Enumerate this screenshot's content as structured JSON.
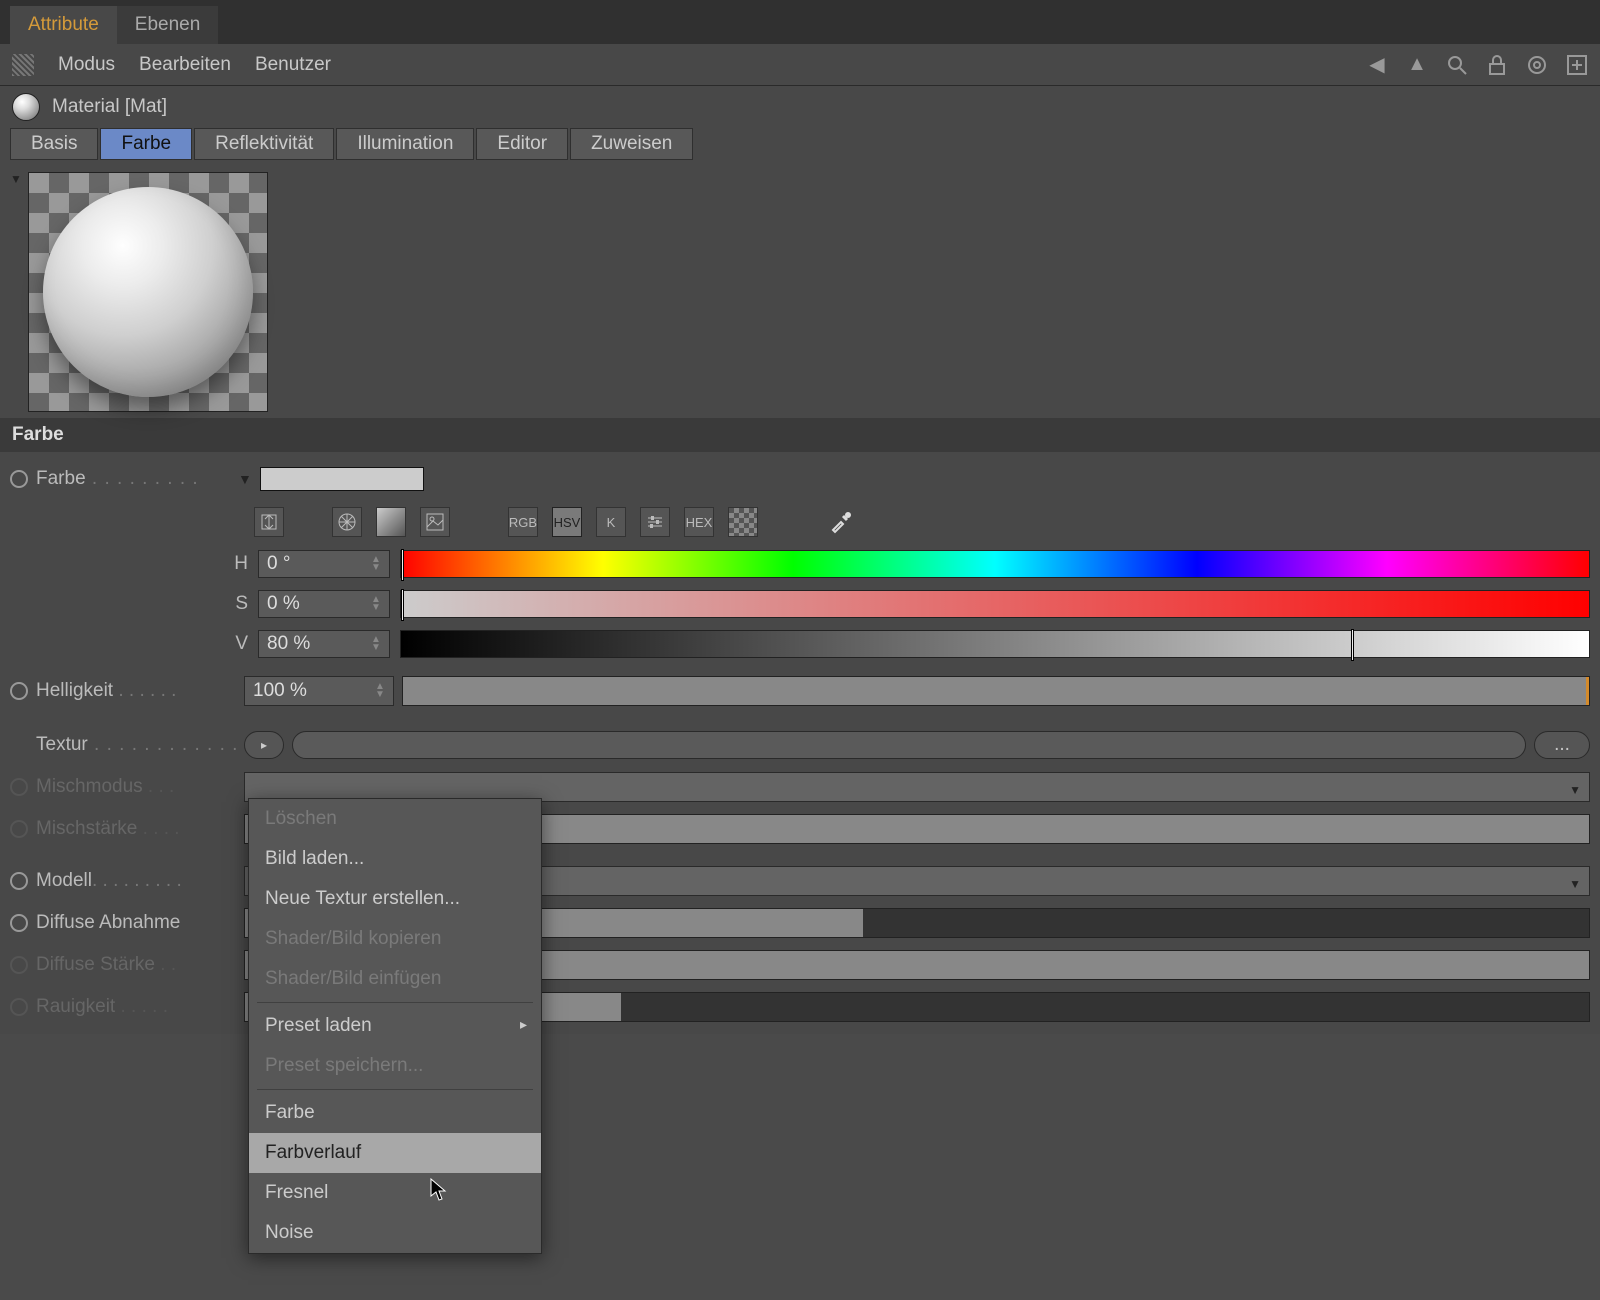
{
  "tabs": {
    "attribute": "Attribute",
    "layers": "Ebenen"
  },
  "menu": {
    "modus": "Modus",
    "bearbeiten": "Bearbeiten",
    "benutzer": "Benutzer"
  },
  "material": {
    "title": "Material [Mat]"
  },
  "mtabs": {
    "basis": "Basis",
    "farbe": "Farbe",
    "reflekt": "Reflektivität",
    "illum": "Illumination",
    "editor": "Editor",
    "zuweisen": "Zuweisen"
  },
  "section": {
    "farbe": "Farbe"
  },
  "labels": {
    "farbe": "Farbe",
    "helligkeit": "Helligkeit",
    "textur": "Textur",
    "mischmodus": "Mischmodus",
    "mischstaerke": "Mischstärke",
    "modell": "Modell",
    "diffabnahme": "Diffuse Abnahme",
    "diffstaerke": "Diffuse Stärke",
    "rauigkeit": "Rauigkeit"
  },
  "icons": {
    "rgb": "RGB",
    "hsv": "HSV",
    "k": "K",
    "hex": "HEX"
  },
  "hsv": {
    "h_label": "H",
    "s_label": "S",
    "v_label": "V",
    "h": "0 °",
    "s": "0 %",
    "v": "80 %"
  },
  "values": {
    "helligkeit": "100 %"
  },
  "texdots": "...",
  "context": {
    "loeschen": "Löschen",
    "bildladen": "Bild laden...",
    "neuetextur": "Neue Textur erstellen...",
    "shaderkopieren": "Shader/Bild kopieren",
    "shadereinfuegen": "Shader/Bild einfügen",
    "presetladen": "Preset laden",
    "presetspeichern": "Preset speichern...",
    "farbe": "Farbe",
    "farbverlauf": "Farbverlauf",
    "fresnel": "Fresnel",
    "noise": "Noise"
  }
}
